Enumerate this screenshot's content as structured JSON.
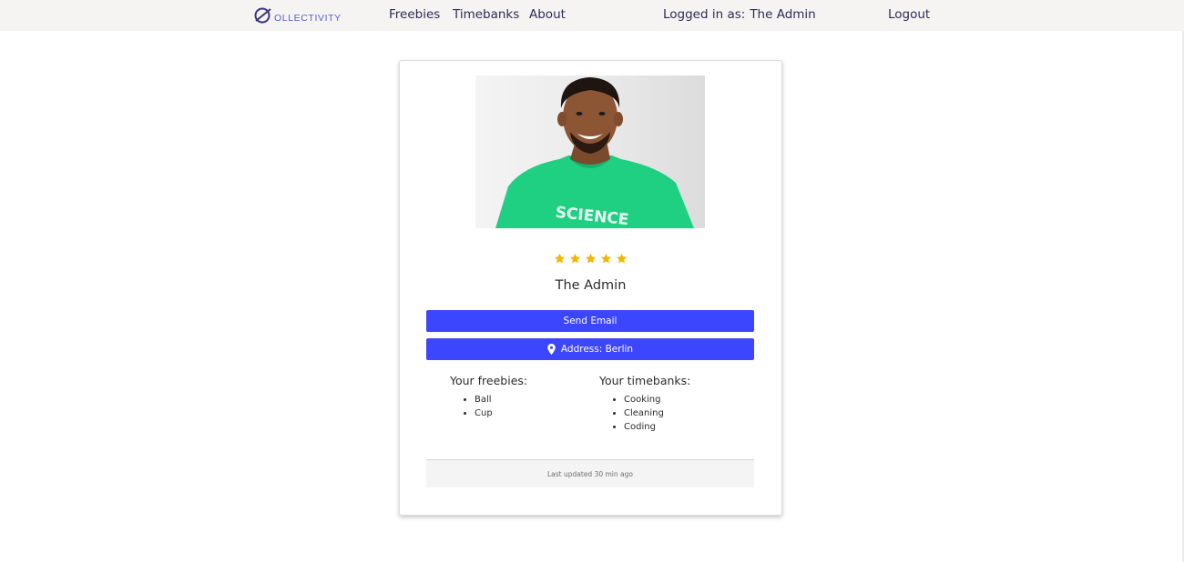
{
  "header": {
    "logo_text": "OLLECTIVITY",
    "nav": [
      {
        "label": "Freebies"
      },
      {
        "label": "Timebanks"
      },
      {
        "label": "About"
      }
    ],
    "logged_in_label": "Logged in as:",
    "logged_in_user": "The Admin",
    "logout_label": "Logout"
  },
  "profile": {
    "photo_icon": "profile-photo",
    "shirt_text": "SCIENCE",
    "rating": 5,
    "rating_max": 5,
    "star_color": "#f2b705",
    "name": "The Admin",
    "send_email_label": "Send Email",
    "address_label": "Address: Berlin",
    "address_icon": "map-marker-icon",
    "freebies_title": "Your freebies:",
    "freebies": [
      "Ball",
      "Cup"
    ],
    "timebanks_title": "Your timebanks:",
    "timebanks": [
      "Cooking",
      "Cleaning",
      "Coding"
    ],
    "footer_text": "Last updated 30 min ago"
  },
  "colors": {
    "button": "#3d46ff",
    "header_bg": "#f5f4f2",
    "nav_text": "#2e2c52",
    "logo": "#5a63c8"
  }
}
